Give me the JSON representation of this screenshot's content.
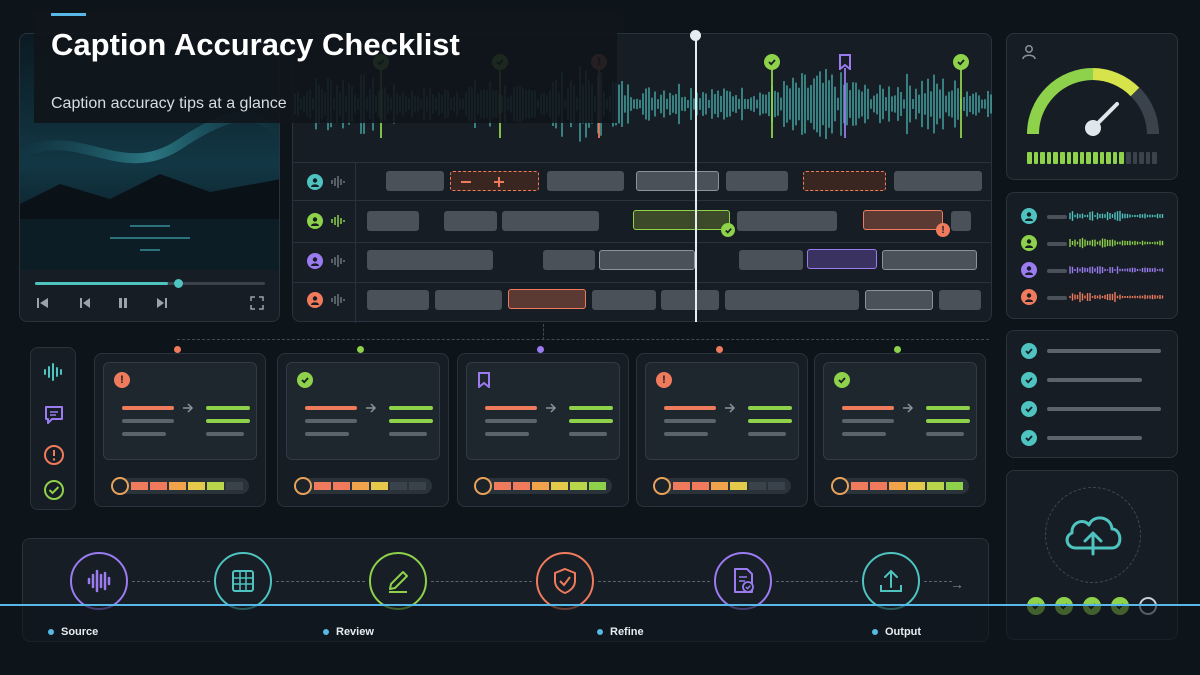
{
  "header": {
    "title": "Caption Accuracy Checklist",
    "subtitle": "Caption accuracy tips at a glance"
  },
  "colors": {
    "background": "#0d141a",
    "teal": "#4fc3c0",
    "green": "#8ed14a",
    "purple": "#9a7bf0",
    "coral": "#ef7b5c",
    "accent_blue": "#58b8e8"
  },
  "video_player": {
    "progress": 0.58,
    "controls": [
      "skip-back-icon",
      "previous-icon",
      "pause-icon",
      "next-icon",
      "fullscreen-icon"
    ]
  },
  "timeline": {
    "markers": [
      "check-icon",
      "check-icon",
      "alert-icon",
      "check-icon",
      "bookmark-icon",
      "check-icon"
    ],
    "tracks": [
      "speaker-teal",
      "speaker-green",
      "speaker-purple",
      "speaker-coral"
    ]
  },
  "quality_gauge": {
    "level": 0.72,
    "meter_filled": 15,
    "meter_total": 20
  },
  "speakers_panel": {
    "speakers": [
      "teal",
      "green",
      "purple",
      "coral"
    ]
  },
  "checklist_panel": {
    "checked_items": 4
  },
  "review_cards": [
    {
      "status": "alert-icon",
      "color": "coral",
      "score": 0.9
    },
    {
      "status": "check-icon",
      "color": "green",
      "score": 0.72
    },
    {
      "status": "bookmark-icon",
      "color": "purple",
      "score": 1.0
    },
    {
      "status": "alert-icon",
      "color": "coral",
      "score": 0.72
    },
    {
      "status": "check-icon",
      "color": "green",
      "score": 1.0
    }
  ],
  "side_toolbar": [
    "waveform-icon",
    "comment-icon",
    "alert-icon",
    "check-circle-icon"
  ],
  "pipeline": {
    "stages": [
      {
        "icon": "waveform-icon",
        "color": "#9a7bf0"
      },
      {
        "icon": "grid-icon",
        "color": "#4fc3c0"
      },
      {
        "icon": "edit-icon",
        "color": "#8ed14a"
      },
      {
        "icon": "shield-check-icon",
        "color": "#ef7b5c"
      },
      {
        "icon": "document-check-icon",
        "color": "#9a7bf0"
      },
      {
        "icon": "upload-icon",
        "color": "#4fc3c0"
      }
    ],
    "labels": {
      "source": "Source",
      "review": "Review",
      "refine": "Refine",
      "output": "Output"
    }
  },
  "upload_panel": {
    "steps_done": 4,
    "steps_total": 5
  }
}
